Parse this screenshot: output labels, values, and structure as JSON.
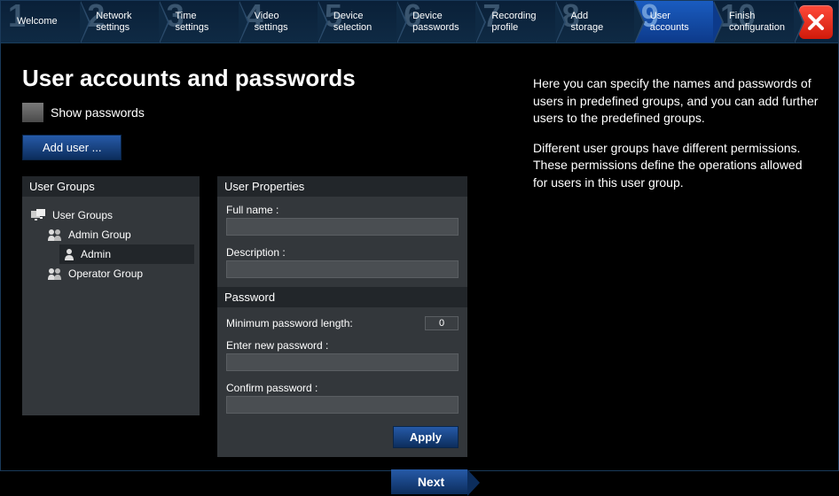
{
  "steps": [
    {
      "num": "1",
      "label": "Welcome"
    },
    {
      "num": "2",
      "label": "Network\nsettings"
    },
    {
      "num": "3",
      "label": "Time\nsettings"
    },
    {
      "num": "4",
      "label": "Video\nsettings"
    },
    {
      "num": "5",
      "label": "Device\nselection"
    },
    {
      "num": "6",
      "label": "Device\npasswords"
    },
    {
      "num": "7",
      "label": "Recording\nprofile"
    },
    {
      "num": "8",
      "label": "Add\nstorage"
    },
    {
      "num": "9",
      "label": "User\naccounts"
    },
    {
      "num": "10",
      "label": "Finish\nconfiguration"
    }
  ],
  "active_step_index": 8,
  "page": {
    "title": "User accounts and passwords",
    "show_passwords_label": "Show passwords",
    "add_user_label": "Add user ...",
    "groups_header": "User Groups",
    "props_header": "User Properties",
    "password_header": "Password",
    "fullname_label": "Full name :",
    "description_label": "Description :",
    "minlen_label": "Minimum password length:",
    "minlen_value": "0",
    "enter_pw_label": "Enter new password :",
    "confirm_pw_label": "Confirm password :",
    "apply_label": "Apply",
    "next_label": "Next",
    "fullname_value": "",
    "description_value": "",
    "enter_pw_value": "",
    "confirm_pw_value": ""
  },
  "tree": {
    "root": "User Groups",
    "groups": [
      {
        "name": "Admin Group",
        "users": [
          "Admin"
        ]
      },
      {
        "name": "Operator Group",
        "users": []
      }
    ],
    "selected": "Admin"
  },
  "help": {
    "p1": "Here you can specify the names and passwords of users in predefined groups, and you can add further users to the predefined groups.",
    "p2": "Different user groups have different permissions. These permissions define the operations allowed for users in this user group."
  }
}
